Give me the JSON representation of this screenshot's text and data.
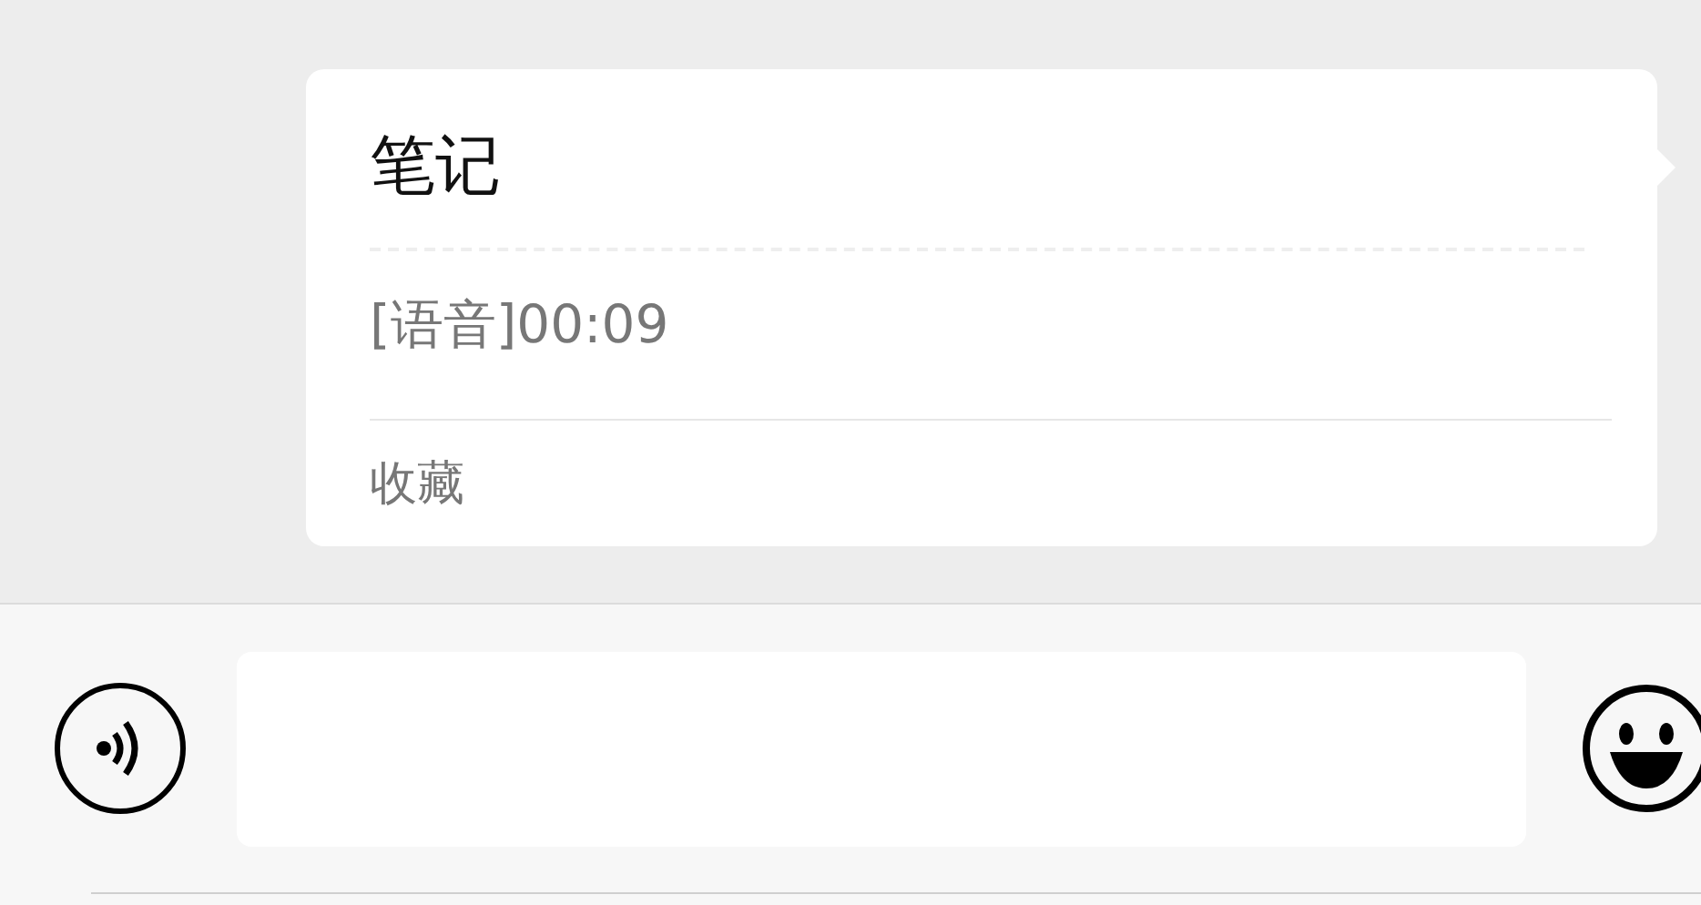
{
  "card": {
    "title": "笔记",
    "message": "[语音]00:09",
    "source": "收藏"
  }
}
